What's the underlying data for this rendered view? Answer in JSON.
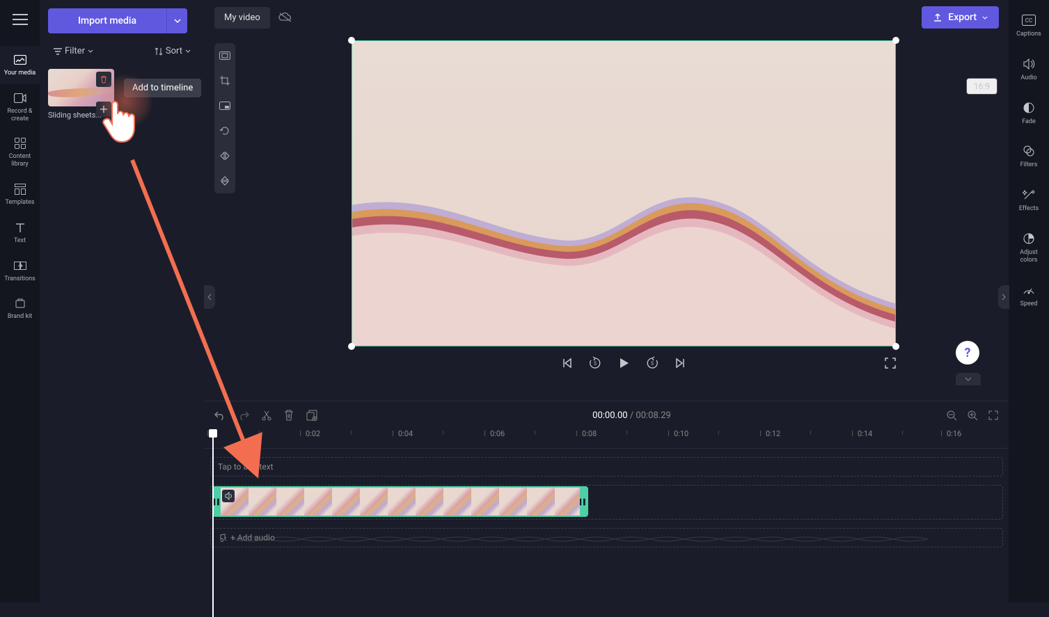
{
  "topbar": {
    "import_label": "Import media",
    "title": "My video",
    "export_label": "Export",
    "aspect": "16:9"
  },
  "filter_sort": {
    "filter_label": "Filter",
    "sort_label": "Sort"
  },
  "media": {
    "thumb_name": "Sliding sheets...",
    "tooltip": "Add to timeline"
  },
  "left_nav": [
    {
      "label": "Your media"
    },
    {
      "label": "Record & create"
    },
    {
      "label": "Content library"
    },
    {
      "label": "Templates"
    },
    {
      "label": "Text"
    },
    {
      "label": "Transitions"
    },
    {
      "label": "Brand kit"
    }
  ],
  "right_nav": [
    {
      "label": "Captions"
    },
    {
      "label": "Audio"
    },
    {
      "label": "Fade"
    },
    {
      "label": "Filters"
    },
    {
      "label": "Effects"
    },
    {
      "label": "Adjust colors"
    },
    {
      "label": "Speed"
    }
  ],
  "timeline": {
    "current": "00:00.00",
    "total": "00:08.29",
    "ruler_start": "0",
    "marks": [
      "0:02",
      "0:04",
      "0:06",
      "0:08",
      "0:10",
      "0:12",
      "0:14",
      "0:16"
    ],
    "text_lane": "Tap to add text",
    "audio_lane": "+ Add audio"
  },
  "help": "?"
}
